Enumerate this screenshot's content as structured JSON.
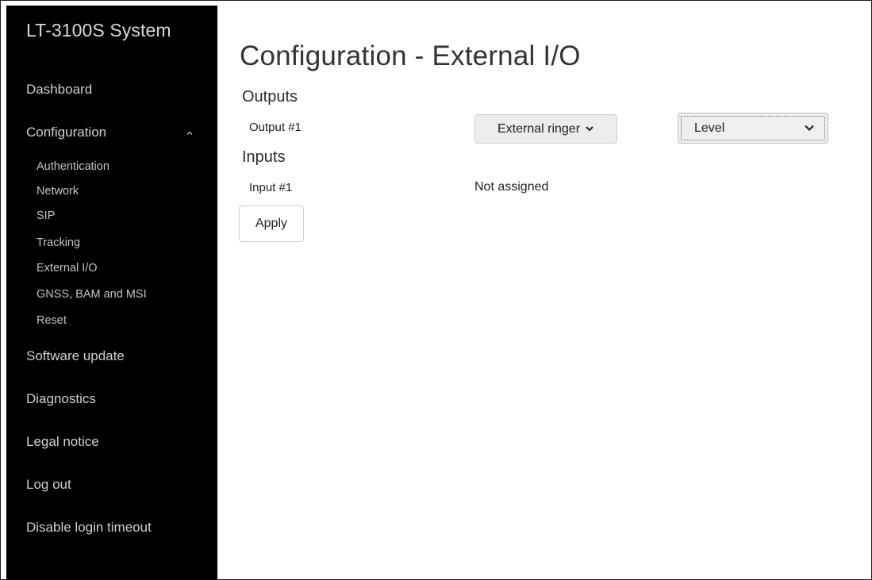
{
  "app": {
    "title": "LT-3100S System"
  },
  "sidebar": {
    "items": [
      {
        "label": "Dashboard"
      },
      {
        "label": "Configuration"
      },
      {
        "label": "Software update"
      },
      {
        "label": "Diagnostics"
      },
      {
        "label": "Legal notice"
      },
      {
        "label": "Log out"
      },
      {
        "label": "Disable login timeout"
      }
    ],
    "config_subitems": [
      {
        "label": "Authentication"
      },
      {
        "label": "Network"
      },
      {
        "label": "SIP"
      },
      {
        "label": "Tracking"
      },
      {
        "label": "External I/O"
      },
      {
        "label": "GNSS, BAM and MSI"
      },
      {
        "label": "Reset"
      }
    ],
    "config_expanded_icon": "chevron-up-icon"
  },
  "main": {
    "title": "Configuration - External I/O",
    "outputs": {
      "heading": "Outputs",
      "rows": [
        {
          "label": "Output #1",
          "function_value": "External ringer",
          "mode_value": "Level"
        }
      ]
    },
    "inputs": {
      "heading": "Inputs",
      "rows": [
        {
          "label": "Input #1",
          "value": "Not assigned"
        }
      ]
    },
    "apply_label": "Apply"
  },
  "colors": {
    "sidebar_bg": "#000000",
    "sidebar_text": "#cfcfcf",
    "page_bg": "#ffffff",
    "button_bg": "#ececec"
  }
}
